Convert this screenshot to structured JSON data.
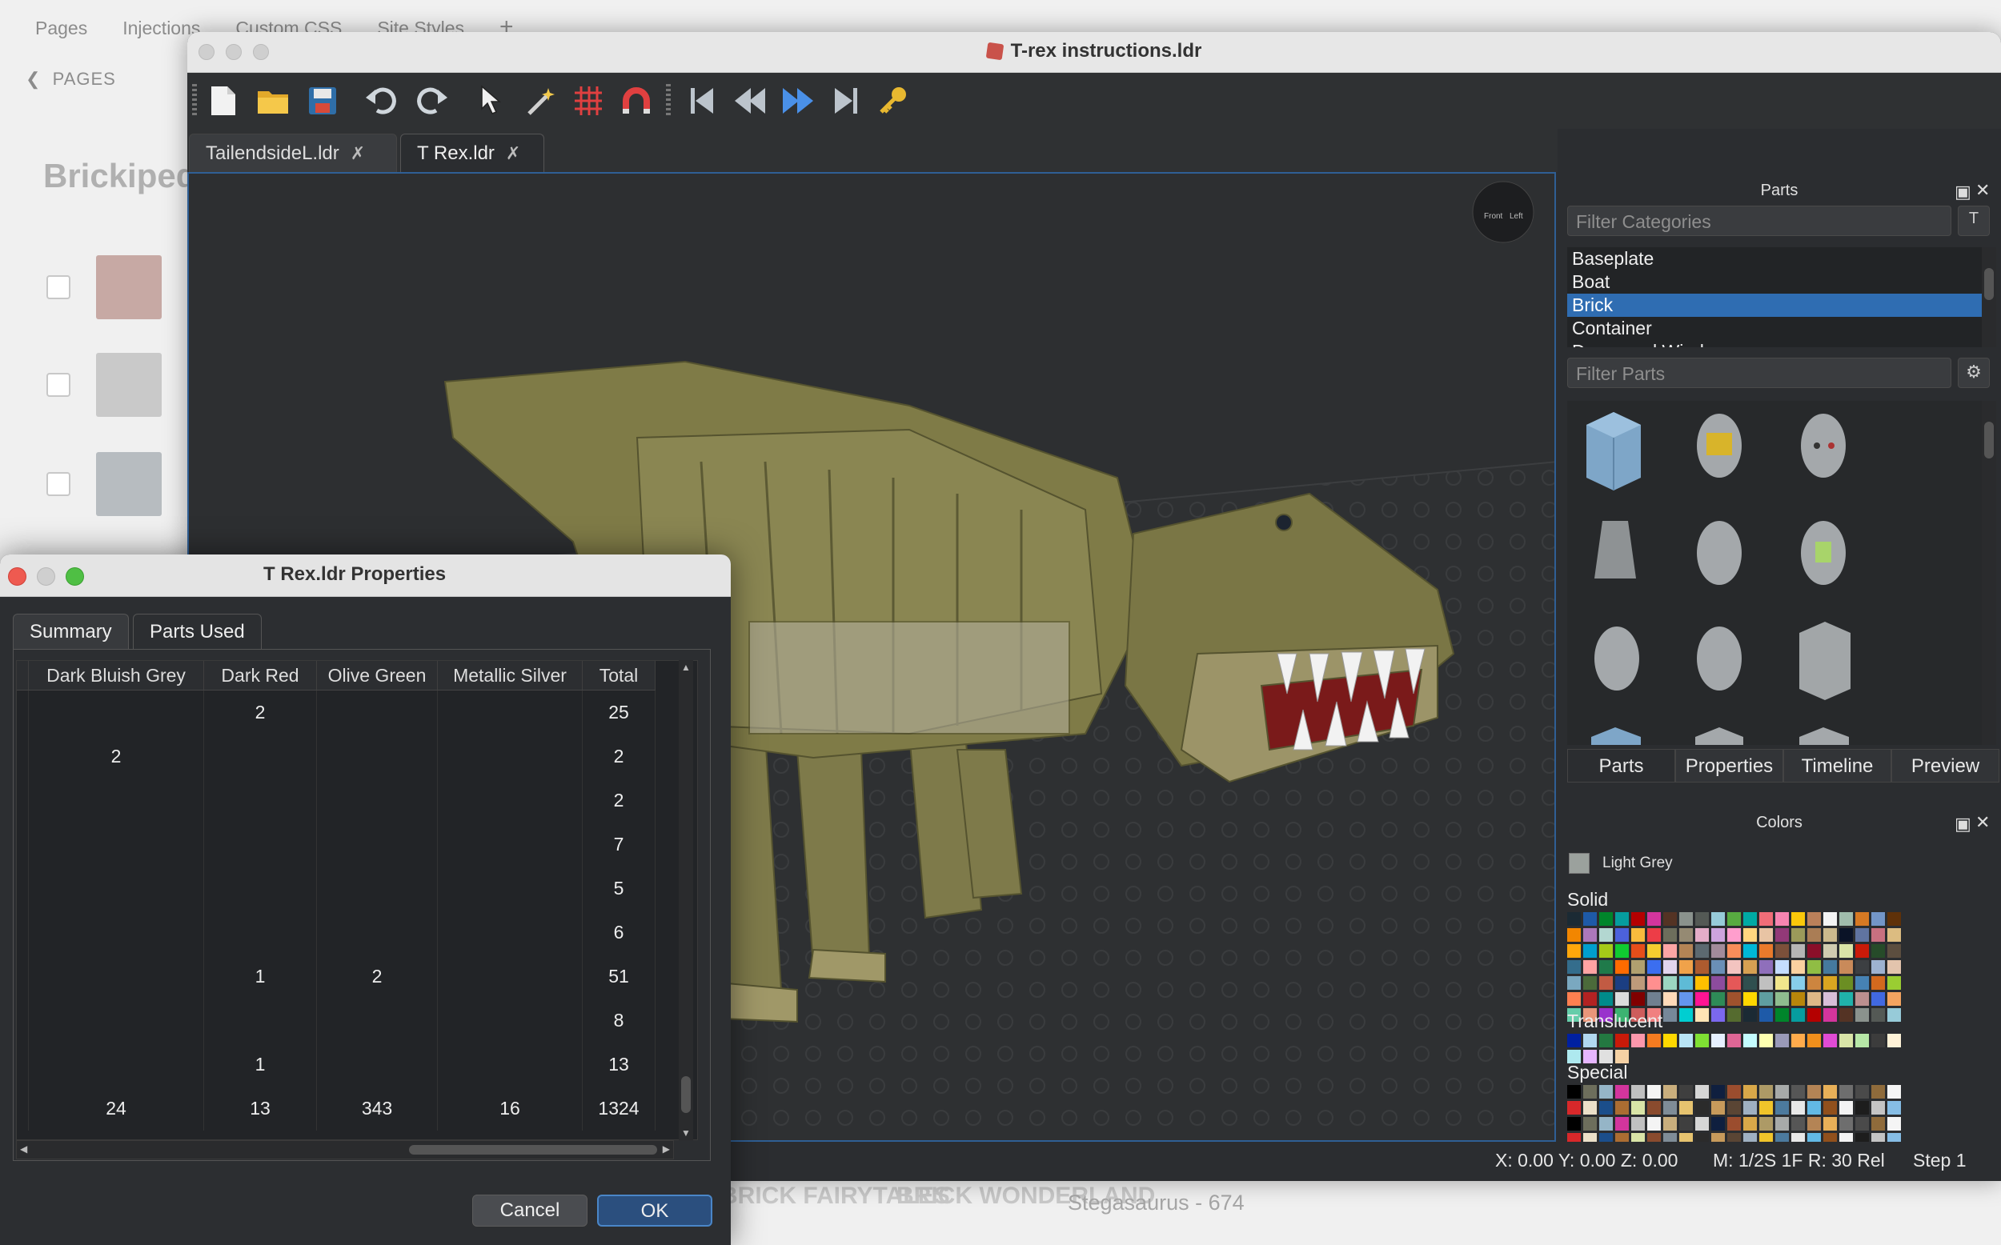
{
  "background_page": {
    "tabs": [
      "Pages",
      "Injections",
      "Custom CSS",
      "Site Styles"
    ],
    "add_tab": "+",
    "back_label": "PAGES",
    "title": "Brickipedia",
    "footer_logos": [
      "BRICK FAIRYTALES",
      "BRICK WONDERLAND"
    ],
    "footer_item": "Stegasaurus - 674"
  },
  "main_window": {
    "title": "T-rex instructions.ldr",
    "toolbar": {
      "new": "new-file-icon",
      "open": "open-folder-icon",
      "save": "save-icon",
      "undo": "undo-icon",
      "redo": "redo-icon",
      "select": "select-cursor-icon",
      "magic": "magic-wand-icon",
      "grid": "grid-snap-icon",
      "magnet": "magnet-icon",
      "first": "first-step-icon",
      "prev": "previous-step-icon",
      "next": "next-step-icon",
      "last": "last-step-icon",
      "key": "key-icon"
    },
    "tabs": [
      {
        "label": "TailendsideL.ldr",
        "active": false
      },
      {
        "label": "T Rex.ldr",
        "active": true
      }
    ],
    "status": {
      "coords": "X: 0.00 Y: 0.00 Z: 0.00",
      "mode": "M: 1/2S 1F R: 30 Rel",
      "step": "Step 1"
    }
  },
  "parts_dock": {
    "title": "Parts",
    "filter_categories_placeholder": "Filter Categories",
    "categories": [
      "Baseplate",
      "Boat",
      "Brick",
      "Container",
      "Doors and Windows"
    ],
    "selected_category": "Brick",
    "filter_parts_placeholder": "Filter Parts",
    "tabs": [
      "Parts",
      "Properties",
      "Timeline",
      "Preview"
    ],
    "active_tab": "Parts"
  },
  "colors_dock": {
    "title": "Colors",
    "current_color": "Light Grey",
    "current_color_hex": "#9ba19d",
    "sections": [
      "Solid",
      "Translucent",
      "Special"
    ]
  },
  "properties_dialog": {
    "title": "T Rex.ldr Properties",
    "tabs": [
      "Summary",
      "Parts Used"
    ],
    "active_tab": "Parts Used",
    "columns": [
      "Dark Bluish Grey",
      "Dark Red",
      "Olive Green",
      "Metallic Silver",
      "Total"
    ],
    "rows": [
      [
        "",
        "2",
        "",
        "",
        "25"
      ],
      [
        "2",
        "",
        "",
        "",
        "2"
      ],
      [
        "",
        "",
        "",
        "",
        "2"
      ],
      [
        "",
        "",
        "",
        "",
        "7"
      ],
      [
        "",
        "",
        "",
        "",
        "5"
      ],
      [
        "",
        "",
        "",
        "",
        "6"
      ],
      [
        "",
        "1",
        "2",
        "",
        "51"
      ],
      [
        "",
        "",
        "",
        "",
        "8"
      ],
      [
        "",
        "1",
        "",
        "",
        "13"
      ],
      [
        "24",
        "13",
        "343",
        "16",
        "1324"
      ]
    ],
    "cancel_label": "Cancel",
    "ok_label": "OK"
  },
  "colors": {
    "accent": "#2f6db2",
    "dark_bg": "#2b2d30",
    "olive_green": "#7d7a45",
    "dark_red": "#8b1a1a"
  }
}
